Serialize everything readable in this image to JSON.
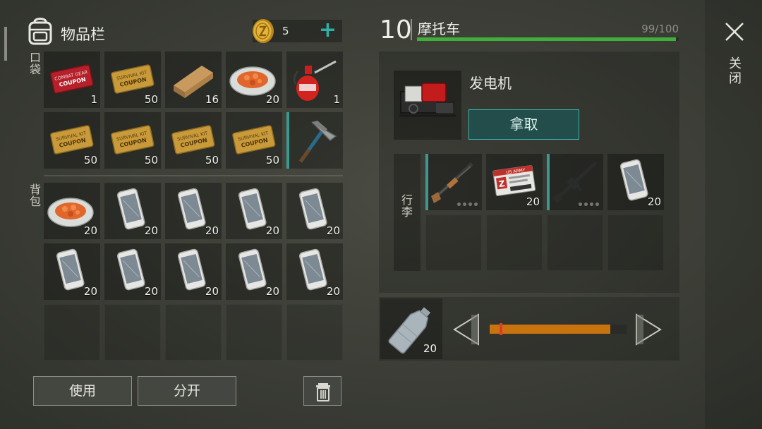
{
  "inventory": {
    "title": "物品栏",
    "coins": "5",
    "add_icon": "plus-icon",
    "pockets_label": "口袋",
    "backpack_label": "背包",
    "pockets": [
      {
        "icon": "combat-gear-coupon",
        "quantity": "1",
        "coupon_lines": [
          "COMBAT GEAR",
          "COUPON"
        ]
      },
      {
        "icon": "survival-kit-coupon",
        "quantity": "50",
        "coupon_lines": [
          "SURVIVAL KIT",
          "COUPON"
        ]
      },
      {
        "icon": "wooden-plank",
        "quantity": "16"
      },
      {
        "icon": "food-plate",
        "quantity": "20"
      },
      {
        "icon": "oil-can",
        "quantity": "1"
      },
      {
        "icon": "survival-kit-coupon",
        "quantity": "50",
        "coupon_lines": [
          "SURVIVAL KIT",
          "COUPON"
        ]
      },
      {
        "icon": "survival-kit-coupon",
        "quantity": "50",
        "coupon_lines": [
          "SURVIVAL KIT",
          "COUPON"
        ]
      },
      {
        "icon": "survival-kit-coupon",
        "quantity": "50",
        "coupon_lines": [
          "SURVIVAL KIT",
          "COUPON"
        ]
      },
      {
        "icon": "survival-kit-coupon",
        "quantity": "50",
        "coupon_lines": [
          "SURVIVAL KIT",
          "COUPON"
        ]
      },
      {
        "icon": "pickaxe",
        "quantity": ""
      }
    ],
    "backpack": [
      {
        "icon": "food-plate",
        "quantity": "20"
      },
      {
        "icon": "smartphone",
        "quantity": "20"
      },
      {
        "icon": "smartphone",
        "quantity": "20"
      },
      {
        "icon": "smartphone",
        "quantity": "20"
      },
      {
        "icon": "smartphone",
        "quantity": "20"
      },
      {
        "icon": "smartphone",
        "quantity": "20"
      },
      {
        "icon": "smartphone",
        "quantity": "20"
      },
      {
        "icon": "smartphone",
        "quantity": "20"
      },
      {
        "icon": "smartphone",
        "quantity": "20"
      },
      {
        "icon": "smartphone",
        "quantity": "20"
      }
    ],
    "empty_slots": 5
  },
  "actions": {
    "use_label": "使用",
    "split_label": "分开",
    "trash_icon": "trash-icon"
  },
  "vehicle": {
    "level": "10",
    "name": "摩托车",
    "durability": "99/100",
    "durability_ratio": 0.99,
    "durability_color": "#3fae3a",
    "generator_name": "发电机",
    "take_label": "拿取",
    "trunk_label": "行李",
    "trunk": [
      {
        "icon": "shotgun",
        "quantity": ""
      },
      {
        "icon": "army-id-card",
        "quantity": "20",
        "card_lines": [
          "US ARMY",
          "Z"
        ]
      },
      {
        "icon": "assault-rifle",
        "quantity": ""
      },
      {
        "icon": "smartphone",
        "quantity": "20"
      }
    ],
    "trunk_empty_slots": 4
  },
  "fuel": {
    "icon": "plastic-bottle",
    "quantity": "20",
    "fill_ratio": 0.88,
    "fill_color": "#c9730f"
  },
  "close_label": "关闭",
  "accent_color": "#3bb6aa"
}
